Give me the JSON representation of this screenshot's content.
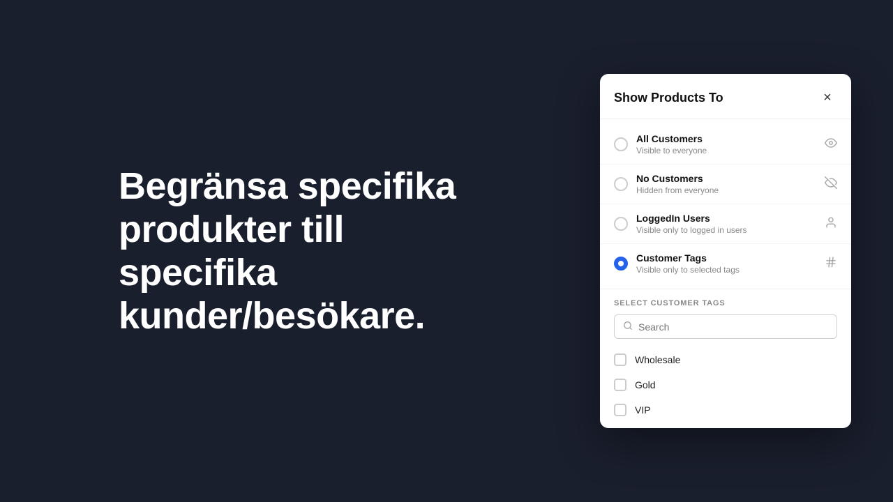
{
  "hero": {
    "text": "Begränsa specifika produkter till specifika kunder/besökare."
  },
  "modal": {
    "title": "Show Products To",
    "close_label": "×",
    "options": [
      {
        "id": "all-customers",
        "title": "All Customers",
        "subtitle": "Visible to everyone",
        "icon": "👁",
        "selected": false
      },
      {
        "id": "no-customers",
        "title": "No Customers",
        "subtitle": "Hidden from everyone",
        "icon": "🚫",
        "selected": false
      },
      {
        "id": "loggedin-users",
        "title": "LoggedIn Users",
        "subtitle": "Visible only to logged in users",
        "icon": "👤",
        "selected": false
      },
      {
        "id": "customer-tags",
        "title": "Customer Tags",
        "subtitle": "Visible only to selected tags",
        "icon": "#",
        "selected": true
      }
    ],
    "tags_section": {
      "label": "SELECT CUSTOMER TAGS",
      "search_placeholder": "Search",
      "tags": [
        {
          "id": "wholesale",
          "label": "Wholesale",
          "checked": false
        },
        {
          "id": "gold",
          "label": "Gold",
          "checked": false
        },
        {
          "id": "vip",
          "label": "VIP",
          "checked": false
        }
      ]
    }
  }
}
